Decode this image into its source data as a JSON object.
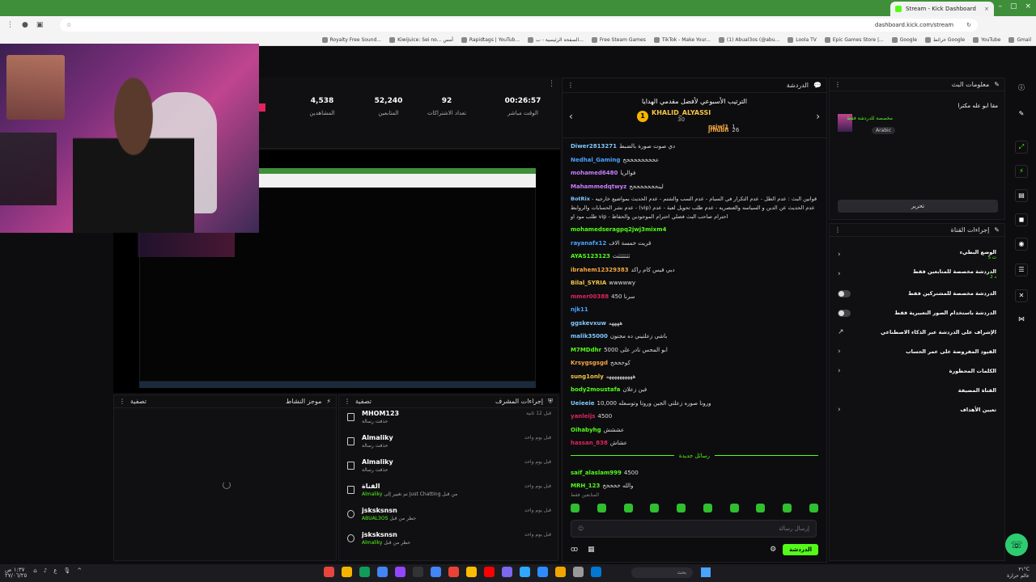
{
  "browser": {
    "tab_title": "Stream - Kick Dashboard",
    "url": "dashboard.kick.com/stream",
    "bookmarks": [
      "Royalty Free Sound...",
      "Kiwijuice: Sei no... أمس",
      "Rapidtags | YouTub...",
      "الصفحة الرئيسية - ب...",
      "Free Steam Games",
      "TikTok - Make Your...",
      "(1) Abual3os (@abu...",
      "Loola TV",
      "Epic Games Store |...",
      "Google",
      "خرائط Google",
      "YouTube",
      "Gmail"
    ]
  },
  "stats": {
    "items": [
      {
        "value": "00:26:57",
        "label": "الوقت مباشر"
      },
      {
        "value": "92",
        "label": "تعداد الاشتراكات"
      },
      {
        "value": "52,240",
        "label": "المتابعين"
      },
      {
        "value": "4,538",
        "label": "المشاهدين"
      }
    ],
    "side_label": "الوقت"
  },
  "chatbot": {
    "title": "موجز النشاط",
    "filter": "تصفية"
  },
  "mod_actions": {
    "title": "إجراءات المشرف",
    "filter": "تصفية",
    "rows": [
      {
        "icon": "trash-icon",
        "user": "MHOM123",
        "action": "حذفت رسالة",
        "when": "قبل 12 ثانية"
      },
      {
        "icon": "trash-icon",
        "user": "Almaliky",
        "action": "حذفت رسالة",
        "when": "قبل يوم واحد"
      },
      {
        "icon": "trash-icon",
        "user": "Almaliky",
        "action": "حذفت رسالة",
        "when": "قبل يوم واحد"
      },
      {
        "icon": "channel-icon",
        "user": "القناة",
        "action": "تم تغيير إلى Just Chatting من قبل",
        "by": "Almaliky",
        "when": "قبل يوم واحد"
      },
      {
        "icon": "ban-icon",
        "user": "jsksksnsn",
        "action": "حظر من قبل",
        "by": "ABUAL3OS",
        "when": "قبل يوم واحد"
      },
      {
        "icon": "ban-icon",
        "user": "jsksksnsn",
        "action": "حظر من قبل",
        "by": "Almaliky",
        "when": "قبل يوم واحد"
      }
    ]
  },
  "chat": {
    "title": "الدردشة",
    "leaderboard_title": "الترتيب الأسبوعي لأفضل مقدمي الهدايا",
    "leader1": {
      "rank": "1",
      "name": "KHALID_ALYASSI",
      "count": "30"
    },
    "leader2": {
      "name": "jfhubh",
      "count": "26"
    },
    "leader3": {
      "name": "nsjwl1",
      "count": "1"
    },
    "messages": [
      {
        "user": "Diwer2813271",
        "color": "#7ec8ff",
        "text": "دي صوت صورة بالضبط"
      },
      {
        "user": "Nedhal_Gaming",
        "color": "#4aa3ff",
        "text": "عخخخخخخخخخ"
      },
      {
        "user": "mohamed6480",
        "color": "#c77dff",
        "text": "فوالريا"
      },
      {
        "user": "Mahammedqtwyz",
        "color": "#c77dff",
        "text": "لينخخخخخخخخ"
      },
      {
        "user": "mohamedseragpq2jwj3mixm4",
        "color": "#53fc18",
        "text": ""
      },
      {
        "user": "rayanafx12",
        "color": "#4aa3ff",
        "text": "قريت خمسة الاف"
      },
      {
        "user": "AYAS123123",
        "color": "#53fc18",
        "text": "ثثثثثثثث"
      },
      {
        "user": "ibrahem12329383",
        "color": "#f5a742",
        "text": "دبي فيس كام راكد"
      },
      {
        "user": "Bilal_SYRIA",
        "color": "#f5c542",
        "text": "wwwwwy"
      },
      {
        "user": "mmer00388",
        "color": "#e0245e",
        "text": "سرنا 450"
      },
      {
        "user": "njk11",
        "color": "#4aa3ff",
        "text": ""
      },
      {
        "user": "ggskevxuw",
        "color": "#7ec8ff",
        "text": "ههههه"
      },
      {
        "user": "malik35000",
        "color": "#7ec8ff",
        "text": "باشي زعلتيني ده مجنون"
      },
      {
        "user": "M7MDdhr",
        "color": "#53fc18",
        "text": "ابو المحس نادر على 5000"
      },
      {
        "user": "Krsygsgsgd",
        "color": "#f5a742",
        "text": "كوخخخخ"
      },
      {
        "user": "sung1only",
        "color": "#f5c542",
        "text": "ههههههههههه"
      },
      {
        "user": "body2moustafa",
        "color": "#53fc18",
        "text": "فين زعلان"
      },
      {
        "user": "Ueieeie",
        "color": "#7ec8ff",
        "text": "10,000 ورونا صوره زعلتي الجين وروتا وتوسعله"
      },
      {
        "user": "yanleijs",
        "color": "#e0245e",
        "text": "4500"
      },
      {
        "user": "Oihabyhg",
        "color": "#53fc18",
        "text": "عششش"
      },
      {
        "user": "hassan_838",
        "color": "#e0245e",
        "text": "عشاش"
      }
    ],
    "bot_message": {
      "user": "BotRix",
      "text": "قوانين البث : عدم الطل - عدم التكرار في السبام - عدم السب والشتم - عدم الحديث بمواضيع خارجيه - عدم نشر الحسابات والروابط - (vip) عدم الحديث عن الدين و السياسه والعنصريه - عدم طلب تحويل لعبة - عدم طلب مود او vip - احترام صاحب البث فضلي احترام الموجودين والحفاظ"
    },
    "new_messages_label": "رسائل جديدة",
    "new_messages": [
      {
        "user": "saif_alaslam999",
        "color": "#53fc18",
        "text": "4500"
      },
      {
        "user": "MRH_123",
        "color": "#53fc18",
        "text": "والله خخخخخ"
      }
    ],
    "followers_only": "المتابعين فقط",
    "input_placeholder": "إرسال رسالة",
    "send_label": "الدردشة"
  },
  "info": {
    "title": "معلومات البث",
    "stream_title": "مقا ابو عله مكترا",
    "category": "مخصصة للدردشة فقط",
    "language": "Arabic",
    "edit_label": "تحرير"
  },
  "actions": {
    "title": "إجراءات القناة",
    "items": [
      {
        "label": "الوضع البطيء",
        "sub": "5 ث",
        "kind": "chevron"
      },
      {
        "label": "الدردشة مخصصة للمتابعين فقط",
        "sub": "2 د",
        "kind": "chevron"
      },
      {
        "label": "الدردشة مخصصة للمشتركين فقط",
        "sub": "",
        "kind": "toggle"
      },
      {
        "label": "الدردشة باستخدام الصور التعبيرية فقط",
        "sub": "",
        "kind": "toggle"
      },
      {
        "label": "الإشراف على الدردشة عبر الذكاء الاصطناعي",
        "sub": "",
        "kind": "link"
      },
      {
        "label": "القيود المفروضة على عمر الحساب",
        "sub": "",
        "kind": "chevron"
      },
      {
        "label": "الكلمات المحظورة",
        "sub": "",
        "kind": "chevron"
      },
      {
        "label": "القناة المضيفة",
        "sub": "",
        "kind": "none"
      },
      {
        "label": "تعيين الأهداف",
        "sub": "",
        "kind": "chevron"
      }
    ]
  },
  "taskbar": {
    "search": "بحث",
    "time": "٣١°C",
    "date": "عالم حرارة",
    "lang": "ع",
    "clock_left": "١:٣٧ ص",
    "date_left": "٢٧/٠٦/٢٥"
  }
}
